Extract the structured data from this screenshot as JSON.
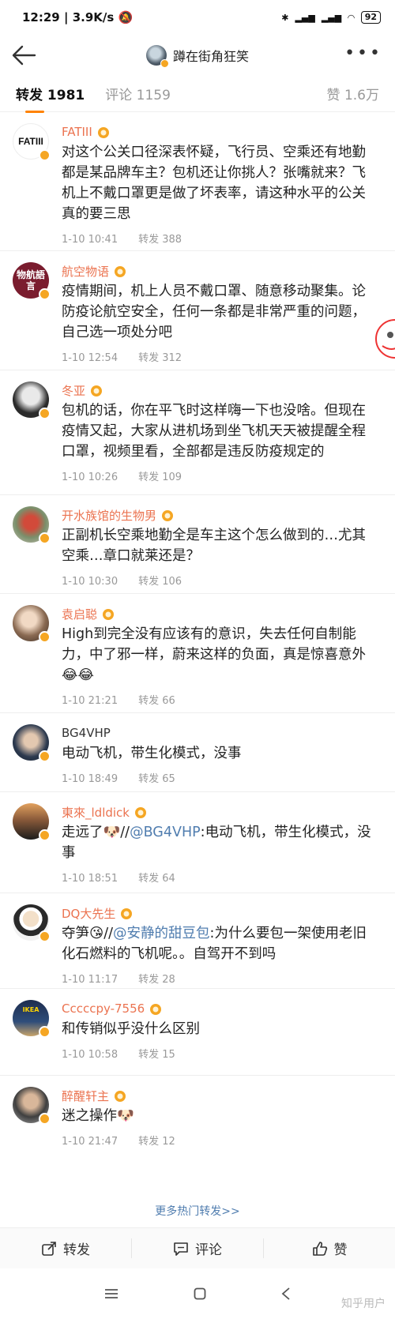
{
  "status": {
    "time": "12:29",
    "speed": "3.9K/s",
    "battery": "92"
  },
  "header": {
    "title": "蹲在街角狂笑"
  },
  "tabs": {
    "repost": "转发 1981",
    "comments": "评论 1159",
    "likes": "赞 1.6万"
  },
  "items": [
    {
      "name": "FATIII",
      "avatar_text": "FATIII",
      "text": "对这个公关口径深表怀疑，飞行员、空乘还有地勤都是某品牌车主？包机还让你挑人？张嘴就来？飞机上不戴口罩更是做了坏表率，请这种水平的公关真的要三思",
      "time": "1-10 10:41",
      "repost": "转发 388"
    },
    {
      "name": "航空物语",
      "avatar_text": "物航語言",
      "text": "疫情期间，机上人员不戴口罩、随意移动聚集。论防疫论航空安全，任何一条都是非常严重的问题，自己选一项处分吧",
      "time": "1-10 12:54",
      "repost": "转发 312"
    },
    {
      "name": "冬亚",
      "text": "包机的话，你在平飞时这样嗨一下也没啥。但现在疫情又起，大家从进机场到坐飞机天天被提醒全程口罩，视频里看，全部都是违反防疫规定的",
      "time": "1-10 10:26",
      "repost": "转发 109"
    },
    {
      "name": "开水族馆的生物男",
      "text": "正副机长空乘地勤全是车主这个怎么做到的…尤其空乘…章口就莱还是？",
      "time": "1-10 10:30",
      "repost": "转发 106"
    },
    {
      "name": "袁启聪",
      "text": "High到完全没有应该有的意识，失去任何自制能力，中了邪一样，蔚来这样的负面，真是惊喜意外",
      "emoji": "😂😂",
      "time": "1-10 21:21",
      "repost": "转发 66"
    },
    {
      "name": "BG4VHP",
      "text": "电动飞机，带生化模式，没事",
      "time": "1-10 18:49",
      "repost": "转发 65"
    },
    {
      "name": "東來_ldldick",
      "text_a": "走远了🐶//",
      "mention": "@BG4VHP",
      "text_b": ":电动飞机，带生化模式，没事",
      "time": "1-10 18:51",
      "repost": "转发 64"
    },
    {
      "name": "DQ大先生",
      "text_a": "夺笋😘//",
      "mention": "@安静的甜豆包",
      "text_b": ":为什么要包一架使用老旧化石燃料的飞机呢。。自驾开不到吗",
      "time": "1-10 11:17",
      "repost": "转发 28"
    },
    {
      "name": "Cccccpy-7556",
      "avatar_text": "IKEA",
      "text": "和传销似乎没什么区别",
      "time": "1-10 10:58",
      "repost": "转发 15"
    },
    {
      "name": "醉醒轩主",
      "text": "迷之操作🐶",
      "time": "1-10 21:47",
      "repost": "转发 12"
    }
  ],
  "more_hot": "更多热门转发>>",
  "actions": {
    "repost": "转发",
    "comment": "评论",
    "like": "赞"
  },
  "watermark": "知乎用户"
}
